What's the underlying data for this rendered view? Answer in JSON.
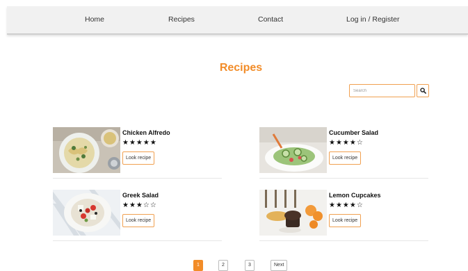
{
  "nav": {
    "home": "Home",
    "recipes": "Recipes",
    "contact": "Contact",
    "login": "Log in / Register"
  },
  "page": {
    "title": "Recipes"
  },
  "search": {
    "placeholder": "Search",
    "icon": "search-icon"
  },
  "recipes": [
    {
      "name": "Chicken Alfredo",
      "rating": 5,
      "stars": "★★★★★",
      "button": "Look recipe"
    },
    {
      "name": "Cucumber Salad",
      "rating": 4,
      "stars": "★★★★☆",
      "button": "Look recipe"
    },
    {
      "name": "Greek Salad",
      "rating": 3,
      "stars": "★★★☆☆",
      "button": "Look recipe"
    },
    {
      "name": "Lemon Cupcakes",
      "rating": 4,
      "stars": "★★★★☆",
      "button": "Look recipe"
    }
  ],
  "pagination": {
    "pages": [
      "1",
      "2",
      "3"
    ],
    "current": "1",
    "next": "Next"
  },
  "colors": {
    "accent": "#f28c28",
    "navbar": "#f1f1f1"
  }
}
